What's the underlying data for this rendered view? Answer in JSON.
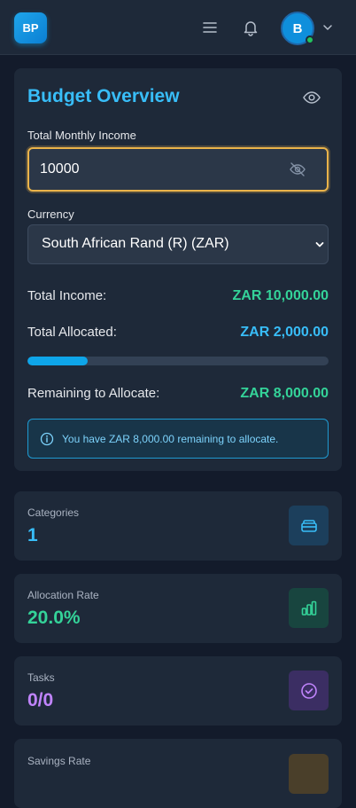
{
  "header": {
    "logo_text": "BP",
    "avatar_initial": "B",
    "icons": [
      "menu-icon",
      "bell-icon",
      "chevron-down-icon"
    ]
  },
  "budget": {
    "title": "Budget Overview",
    "income_label": "Total Monthly Income",
    "income_value": "10000",
    "currency_label": "Currency",
    "currency_value": "South African Rand (R) (ZAR)",
    "total_income_label": "Total Income:",
    "total_income_value": "ZAR 10,000.00",
    "total_allocated_label": "Total Allocated:",
    "total_allocated_value": "ZAR 2,000.00",
    "allocation_progress": 0.2,
    "remaining_label": "Remaining to Allocate:",
    "remaining_value": "ZAR 8,000.00",
    "info_message": "You have ZAR 8,000.00 remaining to allocate."
  },
  "stats": [
    {
      "label": "Categories",
      "value": "1",
      "icon": "wallet-icon"
    },
    {
      "label": "Allocation Rate",
      "value": "20.0%",
      "icon": "bar-chart-icon"
    },
    {
      "label": "Tasks",
      "value": "0/0",
      "icon": "check-circle-icon"
    },
    {
      "label": "Savings Rate",
      "value": "",
      "icon": "piggy-bank-icon"
    }
  ],
  "colors": {
    "accent_blue": "#38bdf8",
    "accent_green": "#34d399",
    "accent_purple": "#c084fc",
    "input_focus": "#eab34a"
  }
}
